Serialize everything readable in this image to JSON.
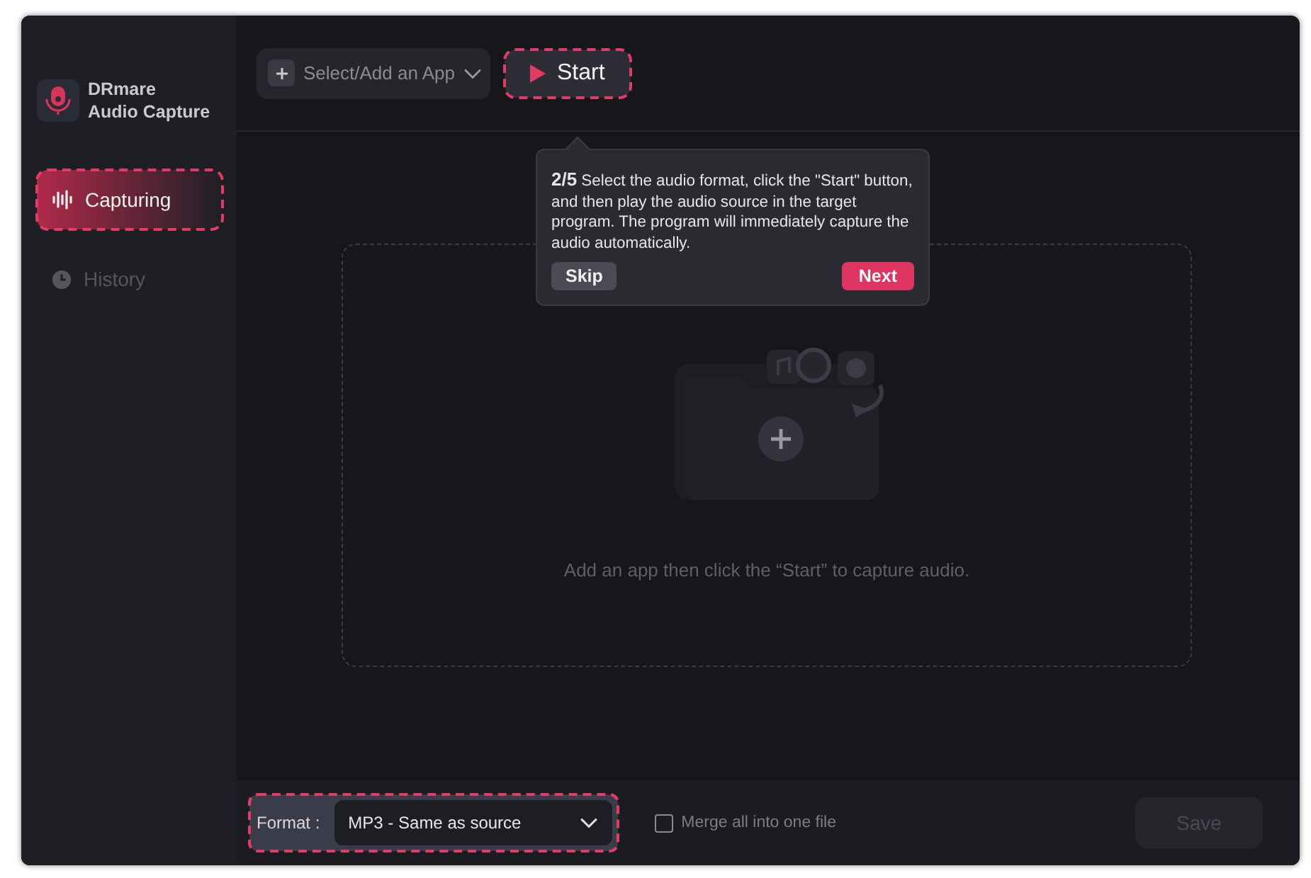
{
  "app": {
    "name_lines": [
      "DRmare",
      "Audio Capture"
    ]
  },
  "nav": [
    {
      "kind": "capture",
      "label": "Capturing",
      "selected": true,
      "highlighted": true
    },
    {
      "kind": "history",
      "label": "History",
      "selected": false,
      "highlighted": false
    }
  ],
  "toolbar": {
    "app_select": {
      "label": "Select/Add an App"
    },
    "start_button": {
      "label": "Start",
      "highlighted": true
    }
  },
  "tooltip": {
    "text": "**2/5** Select the audio format, click the \"Start\" button, and then play the audio source in the target program. The program will immediately capture the audio automatically.",
    "skip": "Skip",
    "next": "Next"
  },
  "dropzone": {
    "hint": "Add an app then click the “Start” to capture audio."
  },
  "bottom_bar": {
    "format": {
      "label": "Format :",
      "value": "MP3 - Same as source",
      "highlighted": true
    },
    "merge": {
      "label": "Merge all into one file",
      "checked": false
    },
    "save": {
      "label": "Save",
      "disabled": true
    }
  }
}
